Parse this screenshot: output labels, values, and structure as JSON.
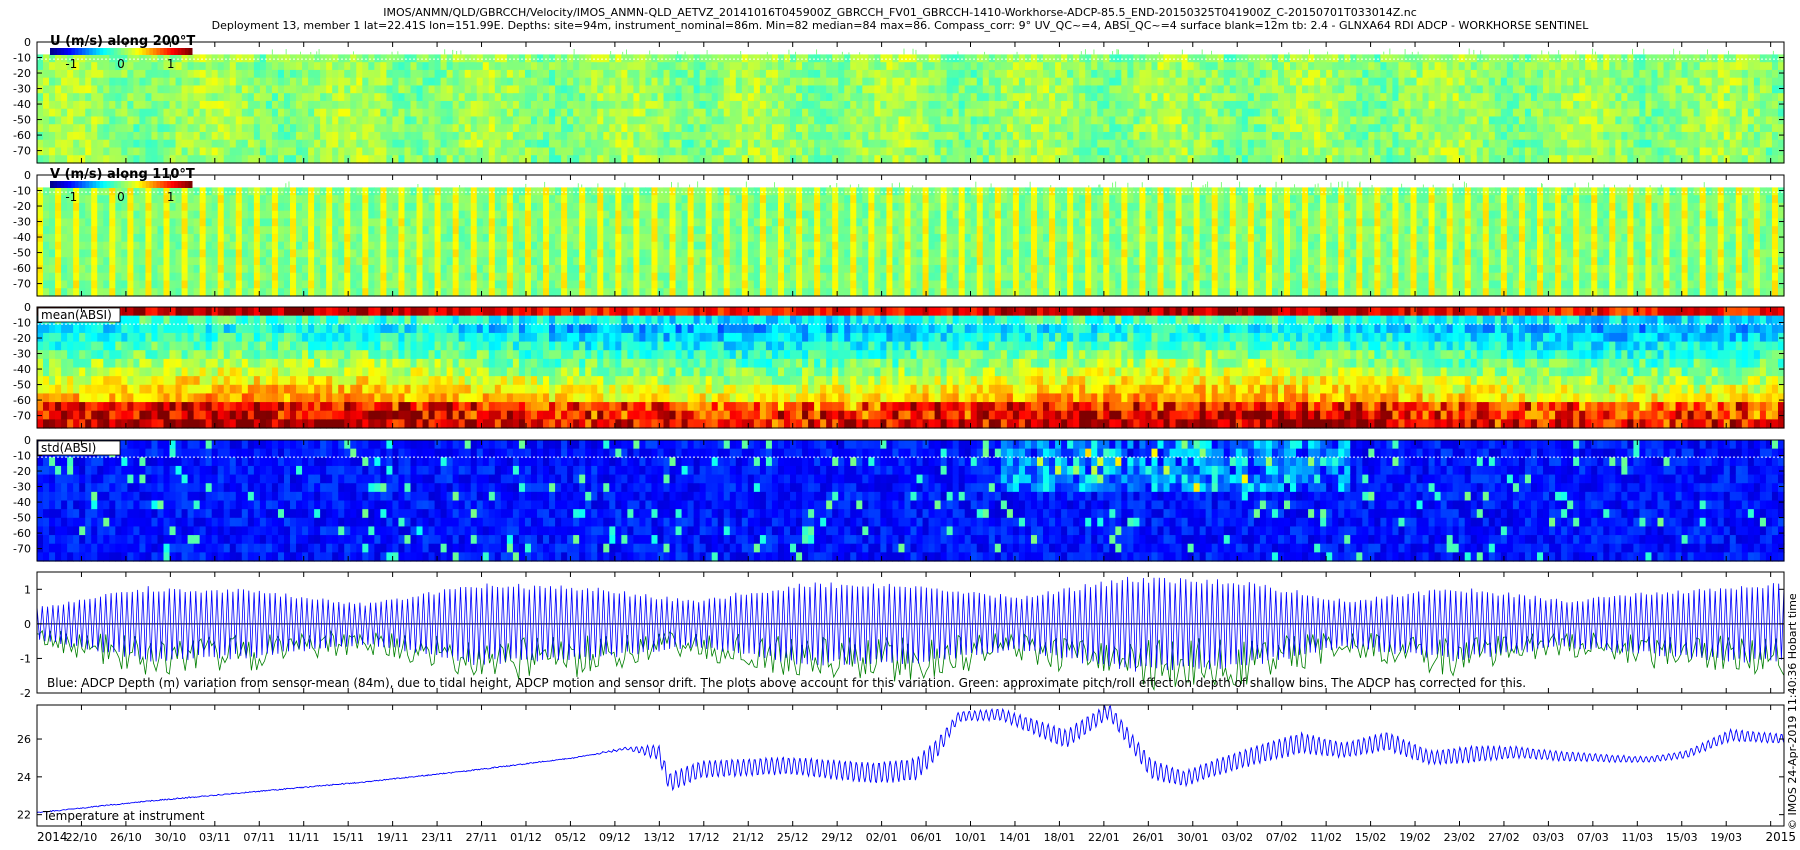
{
  "header": {
    "line1": "IMOS/ANMN/QLD/GBRCCH/Velocity/IMOS_ANMN-QLD_AETVZ_20141016T045900Z_GBRCCH_FV01_GBRCCH-1410-Workhorse-ADCP-85.5_END-20150325T041900Z_C-20150701T033014Z.nc",
    "line2": "Deployment 13, member 1 lat=22.41S lon=151.99E. Depths: site=94m, instrument_nominal=86m. Min=82 median=84 max=86. Compass_corr: 9° UV_QC~=4, ABSI_QC~=4 surface blank=12m tb: 2.4 - GLNXA64 RDI ADCP - WORKHORSE SENTINEL"
  },
  "side_label": "© IMOS 24-Apr-2019 11:40:36 Hobart time",
  "colors": {
    "depth_line": "#0000ff",
    "pitch_roll": "#007f00",
    "temperature": "#0000ff",
    "colormap": [
      "#00008f",
      "#0000ff",
      "#007fff",
      "#00ffff",
      "#7fff7f",
      "#ffff00",
      "#ff7f00",
      "#ff0000",
      "#7f0000"
    ]
  },
  "chart_data": [
    {
      "type": "heatmap",
      "name": "U (m/s) along 200°T",
      "legend_label": "U (m/s) along 200°T",
      "colorbar_ticks": [
        "-1",
        "0",
        "1"
      ],
      "y_ticks": [
        "0",
        "-10",
        "-20",
        "-30",
        "-40",
        "-50",
        "-60",
        "-70"
      ],
      "ylim": [
        -78,
        0
      ],
      "blank_above": -8,
      "dotted_line": -11
    },
    {
      "type": "heatmap",
      "name": "V (m/s) along 110°T",
      "legend_label": "V (m/s) along 110°T",
      "colorbar_ticks": [
        "-1",
        "0",
        "1"
      ],
      "y_ticks": [
        "0",
        "-10",
        "-20",
        "-30",
        "-40",
        "-50",
        "-60",
        "-70"
      ],
      "ylim": [
        -78,
        0
      ],
      "blank_above": -8,
      "dotted_line": -11
    },
    {
      "type": "heatmap",
      "name": "mean(ABSI)",
      "legend_label": "mean(ABSI)",
      "y_ticks": [
        "0",
        "-10",
        "-20",
        "-30",
        "-40",
        "-50",
        "-60",
        "-70"
      ],
      "ylim": [
        -78,
        0
      ],
      "dotted_line": -11
    },
    {
      "type": "heatmap",
      "name": "std(ABSI)",
      "legend_label": "std(ABSI)",
      "y_ticks": [
        "0",
        "-10",
        "-20",
        "-30",
        "-40",
        "-50",
        "-60",
        "-70"
      ],
      "ylim": [
        -78,
        0
      ],
      "dotted_line": -11
    },
    {
      "type": "line",
      "name": "ADCP depth variation",
      "y_ticks": [
        "1",
        "0",
        "-1",
        "-2"
      ],
      "ylim": [
        -2,
        1.5
      ],
      "annotation": "Blue: ADCP Depth (m) variation from sensor-mean (84m), due to tidal height, ADCP motion and sensor drift. The plots above account for this variation. Green: approximate pitch/roll effect on depth of shallow bins. The ADCP has corrected for this.",
      "envelope_days": [
        0,
        10,
        20,
        30,
        40,
        50,
        60,
        70,
        80,
        90,
        100,
        110,
        120,
        130,
        140,
        150,
        160
      ],
      "envelope_amplitude_m": [
        0.5,
        1.1,
        1.0,
        0.6,
        1.2,
        1.1,
        0.7,
        1.2,
        1.2,
        0.8,
        1.4,
        1.3,
        0.7,
        1.1,
        0.7,
        1.0,
        1.2
      ]
    },
    {
      "type": "line",
      "name": "Temperature at instrument",
      "legend_label": "Temperature at instrument",
      "y_ticks": [
        "26",
        "24",
        "22"
      ],
      "ylim": [
        21.4,
        27.8
      ],
      "x_days": [
        0,
        10,
        20,
        30,
        40,
        50,
        55,
        58,
        59,
        62,
        70,
        78,
        82,
        84,
        86,
        90,
        96,
        100,
        104,
        107,
        110,
        114,
        118,
        122,
        126,
        130,
        134,
        138,
        142,
        146,
        150,
        154,
        158,
        163
      ],
      "y": [
        22.1,
        22.7,
        23.2,
        23.7,
        24.3,
        25.0,
        25.5,
        25.3,
        23.7,
        24.4,
        24.6,
        24.2,
        24.4,
        25.5,
        27.2,
        27.3,
        26.0,
        27.5,
        24.4,
        23.9,
        24.5,
        25.2,
        25.8,
        25.4,
        25.9,
        25.0,
        25.2,
        25.3,
        25.1,
        25.0,
        24.9,
        25.2,
        26.2,
        26.0
      ],
      "oscillation_amplitude": [
        0,
        0,
        0,
        0,
        0,
        0,
        0.05,
        0.4,
        0.5,
        0.45,
        0.45,
        0.55,
        0.6,
        0.5,
        0.25,
        0.3,
        0.5,
        0.4,
        0.5,
        0.4,
        0.45,
        0.5,
        0.55,
        0.4,
        0.5,
        0.35,
        0.45,
        0.3,
        0.25,
        0.2,
        0.15,
        0.2,
        0.3,
        0.25
      ]
    }
  ],
  "x_axis": {
    "year_left": "2014",
    "year_right": "2015",
    "date_ticks": [
      "22/10",
      "26/10",
      "30/10",
      "03/11",
      "07/11",
      "11/11",
      "15/11",
      "19/11",
      "23/11",
      "27/11",
      "01/12",
      "05/12",
      "09/12",
      "13/12",
      "17/12",
      "21/12",
      "25/12",
      "29/12",
      "02/01",
      "06/01",
      "10/01",
      "14/01",
      "18/01",
      "22/01",
      "26/01",
      "30/01",
      "03/02",
      "07/02",
      "11/02",
      "15/02",
      "19/02",
      "23/02",
      "27/02",
      "03/03",
      "07/03",
      "11/03",
      "15/03",
      "19/03"
    ]
  }
}
